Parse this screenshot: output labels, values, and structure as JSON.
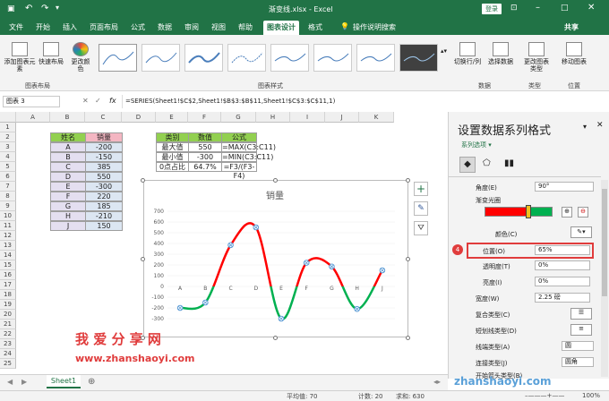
{
  "app": {
    "title": "渐变线.xlsx - Excel",
    "login": "登录",
    "share": "共享",
    "tell_me": "操作说明搜索"
  },
  "menu": [
    "文件",
    "开始",
    "插入",
    "页面布局",
    "公式",
    "数据",
    "审阅",
    "视图",
    "帮助",
    "图表设计",
    "格式"
  ],
  "ribbon": {
    "add_element": "添加图表元素",
    "quick_layout": "快速布局",
    "change_colors": "更改颜色",
    "switch_row_col": "切换行/列",
    "select_data": "选择数据",
    "change_type": "更改图表类型",
    "move_chart": "移动图表",
    "group_layout": "图表布局",
    "group_styles": "图表样式",
    "group_data": "数据",
    "group_type": "类型",
    "group_location": "位置"
  },
  "formula": {
    "namebox": "图表 3",
    "fx": "fx",
    "content": "=SERIES(Sheet1!$C$2,Sheet1!$B$3:$B$11,Sheet1!$C$3:$C$11,1)"
  },
  "columns": [
    "A",
    "B",
    "C",
    "D",
    "E",
    "F",
    "G",
    "H",
    "I",
    "J",
    "K"
  ],
  "rows": [
    "1",
    "2",
    "3",
    "4",
    "5",
    "6",
    "7",
    "8",
    "9",
    "10",
    "11",
    "12",
    "13",
    "14",
    "15",
    "16",
    "17",
    "18",
    "19",
    "20",
    "21",
    "22",
    "23",
    "24",
    "25"
  ],
  "table1": {
    "headers": [
      "姓名",
      "销量"
    ],
    "rows": [
      [
        "A",
        "-200"
      ],
      [
        "B",
        "-150"
      ],
      [
        "C",
        "385"
      ],
      [
        "D",
        "550"
      ],
      [
        "E",
        "-300"
      ],
      [
        "F",
        "220"
      ],
      [
        "G",
        "185"
      ],
      [
        "H",
        "-210"
      ],
      [
        "J",
        "150"
      ]
    ]
  },
  "table2": {
    "headers": [
      "类别",
      "数值",
      "公式"
    ],
    "rows": [
      [
        "最大值",
        "550",
        "=MAX(C3:C11)"
      ],
      [
        "最小值",
        "-300",
        "=MIN(C3:C11)"
      ],
      [
        "0点占比",
        "64.7%",
        "=F3/(F3-F4)"
      ]
    ]
  },
  "chart_data": {
    "type": "line",
    "title": "销量",
    "categories": [
      "A",
      "B",
      "C",
      "D",
      "E",
      "F",
      "G",
      "H",
      "J"
    ],
    "series": [
      {
        "name": "销量",
        "values": [
          -200,
          -150,
          385,
          550,
          -300,
          220,
          185,
          -210,
          150
        ]
      }
    ],
    "ylim": [
      -300,
      700
    ],
    "yticks": [
      -300,
      -200,
      -100,
      0,
      100,
      200,
      300,
      400,
      500,
      600,
      700
    ],
    "gradient_colors": [
      "#ff0000",
      "#00b050"
    ],
    "marker_color": "#5b9bd5"
  },
  "pane": {
    "title": "设置数据系列格式",
    "series_options": "系列选项",
    "angle_label": "角度(E)",
    "angle_value": "90°",
    "gradient_stops_label": "渐变光圈",
    "color_label": "颜色(C)",
    "position_label": "位置(O)",
    "position_value": "65%",
    "transparency_label": "透明度(T)",
    "transparency_value": "0%",
    "brightness_label": "亮度(I)",
    "brightness_value": "0%",
    "width_label": "宽度(W)",
    "width_value": "2.25 磅",
    "compound_label": "复合类型(C)",
    "dash_label": "短划线类型(D)",
    "cap_label": "线端类型(A)",
    "cap_value": "圆",
    "join_label": "连接类型(J)",
    "join_value": "圆角",
    "arrow_label": "开始箭头类型(B)",
    "step_badge": "4"
  },
  "sheet_tab": "Sheet1",
  "status": {
    "average": "平均值: 70",
    "count": "计数: 20",
    "sum": "求和: 630",
    "zoom": "100%"
  },
  "watermark": {
    "cn": "我 爱 分 享 网",
    "url1": "www.zhanshaoyi.com",
    "url2": "zhanshaoyi.com"
  }
}
